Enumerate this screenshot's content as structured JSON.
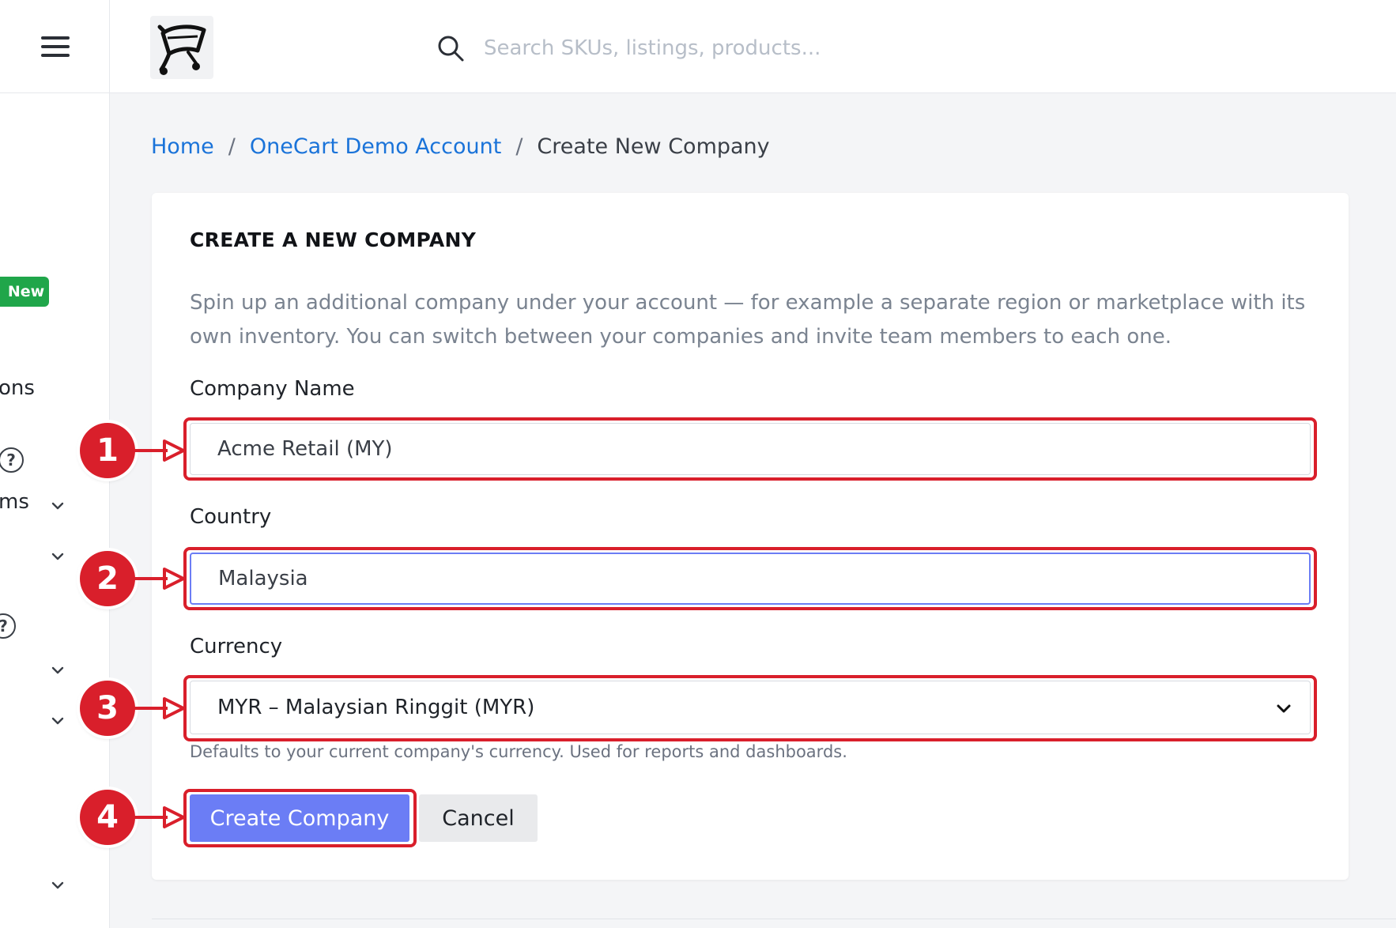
{
  "sidebar": {
    "badge": "New",
    "partial_items": [
      "ons",
      "ms"
    ],
    "help_glyph": "?"
  },
  "header": {
    "search_placeholder": "Search SKUs, listings, products...",
    "logo": "cart-logo"
  },
  "breadcrumb": {
    "home": "Home",
    "account": "OneCart Demo Account",
    "current": "Create New Company",
    "separator": "/"
  },
  "form": {
    "title": "CREATE A NEW COMPANY",
    "description": "Spin up an additional company under your account — for example a separate region or marketplace with its own inventory. You can switch between your companies and invite team members to each one.",
    "company_name_label": "Company Name",
    "company_name_value": "Acme Retail (MY)",
    "country_label": "Country",
    "country_value": "Malaysia",
    "currency_label": "Currency",
    "currency_value": "MYR – Malaysian Ringgit (MYR)",
    "currency_hint": "Defaults to your current company's currency. Used for reports and dashboards.",
    "submit_label": "Create Company",
    "cancel_label": "Cancel"
  },
  "annotations": {
    "steps": [
      "1",
      "2",
      "3",
      "4"
    ],
    "color": "#d91f2b"
  },
  "colors": {
    "primary": "#6b7df5",
    "link": "#1a73d9",
    "badge": "#20a64a",
    "highlight": "#d91f2b"
  }
}
